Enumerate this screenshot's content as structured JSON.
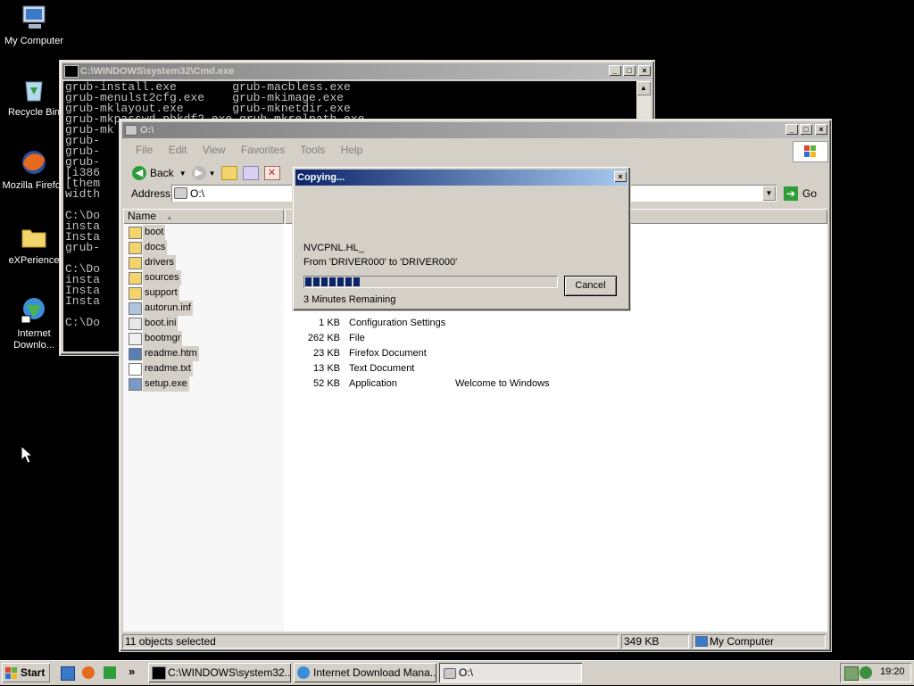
{
  "desktop": {
    "icons": [
      {
        "label": "My Computer"
      },
      {
        "label": "Recycle Bin"
      },
      {
        "label": "Mozilla Firefox"
      },
      {
        "label": "eXPerience"
      },
      {
        "label": "Internet Downlo..."
      }
    ]
  },
  "cmd_window": {
    "title": "C:\\WINDOWS\\system32\\Cmd.exe",
    "lines": [
      "grub-install.exe        grub-macbless.exe",
      "grub-menulst2cfg.exe    grub-mkimage.exe",
      "grub-mklayout.exe       grub-mknetdir.exe",
      "grub-mkpasswd-pbkdf2.exe grub-mkrelpath.exe",
      "grub-mk",
      "grub-",
      "grub-",
      "grub-",
      "[i386",
      "[them",
      "width",
      "",
      "C:\\Do",
      "insta",
      "Insta",
      "grub-",
      "",
      "C:\\Do",
      "insta",
      "Insta",
      "Insta",
      "",
      "C:\\Do"
    ]
  },
  "explorer": {
    "title": "O:\\",
    "menu": [
      "File",
      "Edit",
      "View",
      "Favorites",
      "Tools",
      "Help"
    ],
    "toolbar": {
      "back": "Back"
    },
    "address_label": "Address",
    "address_value": "O:\\",
    "go_label": "Go",
    "column_name": "Name",
    "files": [
      {
        "name": "boot",
        "size": "",
        "type": "",
        "extra": "",
        "icon": "folder-icon"
      },
      {
        "name": "docs",
        "size": "",
        "type": "",
        "extra": "",
        "icon": "folder-icon"
      },
      {
        "name": "drivers",
        "size": "",
        "type": "",
        "extra": "",
        "icon": "folder-icon"
      },
      {
        "name": "sources",
        "size": "",
        "type": "",
        "extra": "",
        "icon": "folder-icon"
      },
      {
        "name": "support",
        "size": "",
        "type": "",
        "extra": "",
        "icon": "folder-icon"
      },
      {
        "name": "autorun.inf",
        "size": "",
        "type": "",
        "extra": "",
        "icon": "setup-info-icon"
      },
      {
        "name": "boot.ini",
        "size": "1 KB",
        "type": "Configuration Settings",
        "extra": "",
        "icon": "config-file-icon"
      },
      {
        "name": "bootmgr",
        "size": "262 KB",
        "type": "File",
        "extra": "",
        "icon": "file-icon"
      },
      {
        "name": "readme.htm",
        "size": "23 KB",
        "type": "Firefox Document",
        "extra": "",
        "icon": "html-file-icon"
      },
      {
        "name": "readme.txt",
        "size": "13 KB",
        "type": "Text Document",
        "extra": "",
        "icon": "text-file-icon"
      },
      {
        "name": "setup.exe",
        "size": "52 KB",
        "type": "Application",
        "extra": "Welcome to Windows",
        "icon": "application-icon"
      }
    ],
    "status": {
      "selected": "11 objects selected",
      "size": "349 KB",
      "location": "My Computer"
    }
  },
  "copy_dialog": {
    "title": "Copying...",
    "filename": "NVCPNL.HL_",
    "from_to": "From 'DRIVER000' to 'DRIVER000'",
    "progress": 0.22,
    "remaining": "3 Minutes Remaining",
    "cancel_label": "Cancel"
  },
  "taskbar": {
    "start_label": "Start",
    "tasks": [
      {
        "label": "C:\\WINDOWS\\system32..."
      },
      {
        "label": "Internet Download Mana..."
      },
      {
        "label": "O:\\"
      }
    ],
    "chevron": "»",
    "clock": "19:20"
  },
  "colors": {
    "desktop": "#000000",
    "active_title_start": "#0a246a",
    "active_title_end": "#a6caf0",
    "progress_fill": "#0a246a"
  }
}
